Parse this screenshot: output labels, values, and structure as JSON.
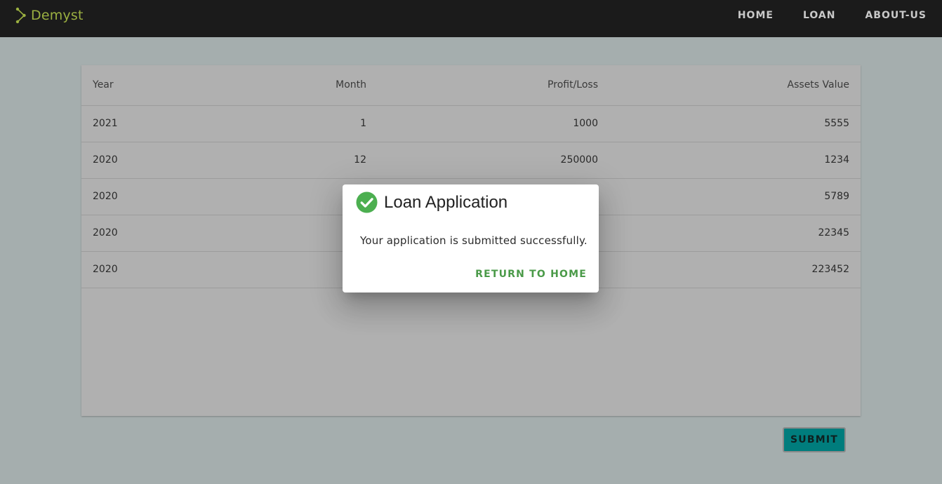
{
  "brand": {
    "name": "Demyst",
    "color": "#9bb041"
  },
  "nav": {
    "items": [
      {
        "label": "HOME"
      },
      {
        "label": "LOAN"
      },
      {
        "label": "ABOUT-US"
      }
    ]
  },
  "table": {
    "headers": [
      "Year",
      "Month",
      "Profit/Loss",
      "Assets Value"
    ],
    "rows": [
      [
        "2021",
        "1",
        "1000",
        "5555"
      ],
      [
        "2020",
        "12",
        "250000",
        "1234"
      ],
      [
        "2020",
        "",
        "",
        "5789"
      ],
      [
        "2020",
        "",
        "",
        "22345"
      ],
      [
        "2020",
        "",
        "",
        "223452"
      ]
    ]
  },
  "submit": {
    "label": "SUBMIT",
    "color": "#007d7d"
  },
  "dialog": {
    "title": "Loan Application",
    "message": "Your application is submitted successfully.",
    "action": "RETURN TO HOME",
    "icon": "check-circle-icon",
    "accent": "#4caf50"
  }
}
